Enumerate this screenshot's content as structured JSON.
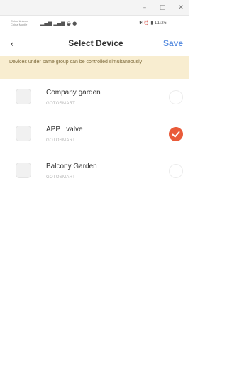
{
  "window": {
    "min_glyph": "–",
    "max_glyph": "□",
    "close_glyph": "✕"
  },
  "status_bar": {
    "carrier_line1": "China Unicom",
    "carrier_line2": "China Mobile",
    "signal_text": "▂▄▆ ▂▄▆ ◒ ●",
    "right_text": "✱ ⏰ ▮ 11:26"
  },
  "nav": {
    "back_glyph": "‹",
    "title": "Select Device",
    "save_label": "Save",
    "accent_color": "#5a8ee0"
  },
  "notice": {
    "text": "Devices under same group can be controlled simultaneously"
  },
  "devices": [
    {
      "name": "Company garden",
      "subtitle": "GOTOSMART",
      "selected": false
    },
    {
      "name": "APP   valve",
      "subtitle": "GOTOSMART",
      "selected": true
    },
    {
      "name": "Balcony Garden",
      "subtitle": "GOTOSMART",
      "selected": false
    }
  ],
  "colors": {
    "selected": "#e95b3a",
    "notice_bg": "#f8edd0"
  },
  "icons": {
    "back": "chevron-left-icon",
    "check": "check-icon",
    "device": "device-thumbnail-icon"
  }
}
